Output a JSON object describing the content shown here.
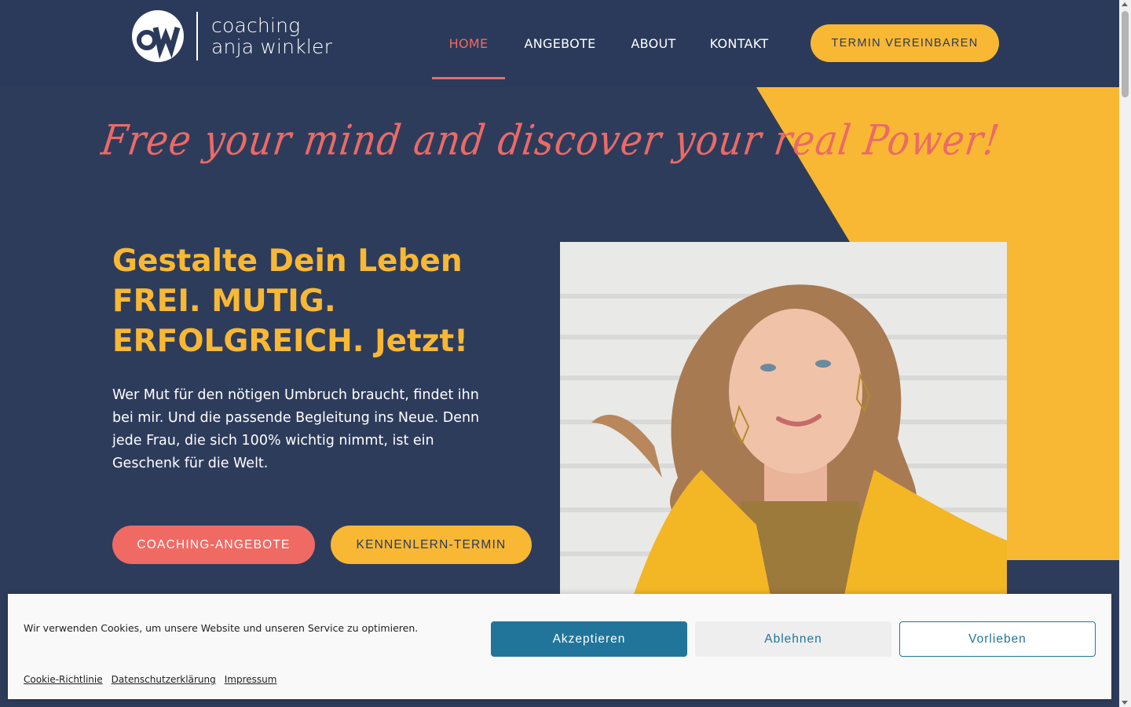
{
  "brand": {
    "logo_initials": "OW",
    "name_line1": "coaching",
    "name_line2": "anja winkler"
  },
  "nav": {
    "items": [
      {
        "label": "HOME",
        "active": true
      },
      {
        "label": "ANGEBOTE",
        "active": false
      },
      {
        "label": "ABOUT",
        "active": false
      },
      {
        "label": "KONTAKT",
        "active": false
      }
    ],
    "cta_label": "TERMIN VEREINBAREN"
  },
  "hero": {
    "tagline": "Free your mind and discover your real Power!",
    "headline_line1": "Gestalte Dein Leben",
    "headline_line2": "FREI. MUTIG.",
    "headline_line3": "ERFOLGREICH. Jetzt!",
    "intro": "Wer Mut für den nötigen Umbruch braucht, findet ihn bei mir. Und die passende Begleitung ins Neue. Denn jede Frau, die sich 100% wichtig nimmt, ist ein Geschenk für die Welt.",
    "btn_primary": "COACHING-ANGEBOTE",
    "btn_secondary": "KENNENLERN-TERMIN"
  },
  "cookie": {
    "message": "Wir verwenden Cookies, um unsere Website und unseren Service zu optimieren.",
    "accept_label": "Akzeptieren",
    "deny_label": "Ablehnen",
    "prefs_label": "Vorlieben",
    "links": [
      "Cookie-Richtlinie",
      "Datenschutzerklärung",
      "Impressum"
    ]
  },
  "colors": {
    "navy": "#2b3a5a",
    "yellow": "#f8b834",
    "coral": "#f06a64",
    "cookie_blue": "#21759b"
  }
}
